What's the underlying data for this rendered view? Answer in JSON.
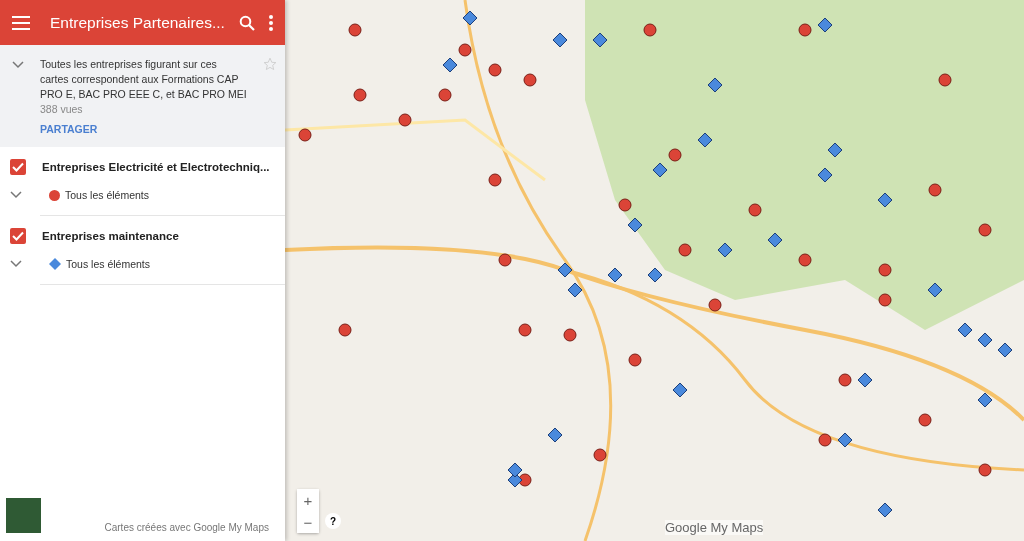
{
  "app_bar": {
    "title": "Entreprises Partenaires..."
  },
  "map_info": {
    "expanded": false,
    "description": "Toutes les entreprises figurant sur ces cartes correspondent aux Formations CAP PRO E, BAC PRO EEE C, et BAC PRO MEI",
    "views": "388 vues",
    "share": "PARTAGER",
    "starred": false
  },
  "layers": [
    {
      "title": "Entreprises Electricité et Electrotechniq...",
      "checked": true,
      "expanded": false,
      "legend": "Tous les éléments",
      "kind": "circle",
      "color": "#db4437"
    },
    {
      "title": "Entreprises maintenance",
      "checked": true,
      "expanded": false,
      "legend": "Tous les éléments",
      "kind": "diamond",
      "color": "#4a89dc"
    }
  ],
  "footer": {
    "credit": "Cartes créées avec Google My Maps"
  },
  "map_controls": {
    "zoom_in": "+",
    "zoom_out": "−",
    "help": "?"
  },
  "map_logo": "Google My Maps"
}
